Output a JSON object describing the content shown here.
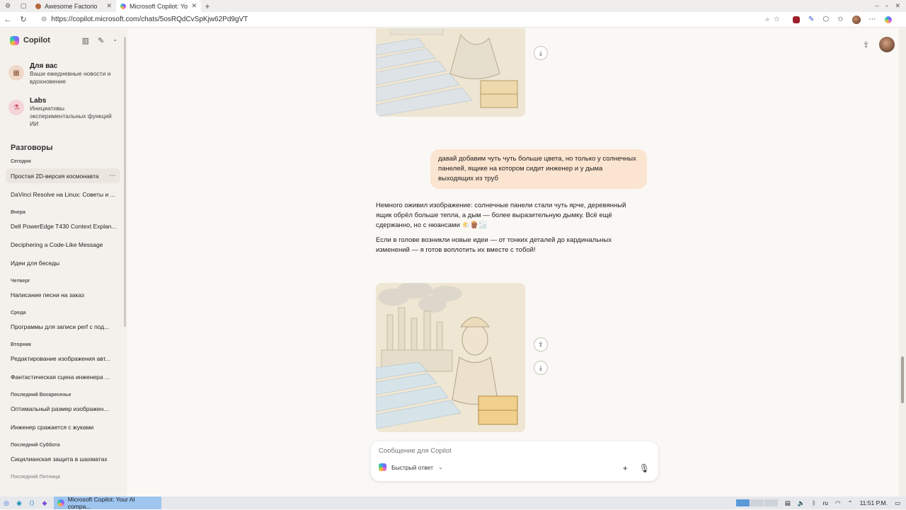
{
  "browser": {
    "tabs": [
      {
        "title": "Awesome Factorio",
        "active": false,
        "icon_color": "#b7683b"
      },
      {
        "title": "Microsoft Copilot: Your",
        "active": true,
        "icon_color": "#4f8cf7"
      }
    ],
    "url": "https://copilot.microsoft.com/chats/5osRQdCvSpKjw62Pd9gVT"
  },
  "sidebar": {
    "brand": "Copilot",
    "features": [
      {
        "title": "Для вас",
        "desc": "Ваши ежедневные новости и вдохновение",
        "icon": "grid-icon"
      },
      {
        "title": "Labs",
        "desc": "Инициативы экспериментальных функций ИИ",
        "icon": "flask-icon"
      }
    ],
    "section_title": "Разговоры",
    "groups": [
      {
        "label": "Сегодня",
        "items": [
          "Простая 2D-версия космонавта",
          "DaVinci Resolve на Linux: Советы и ..."
        ]
      },
      {
        "label": "Вчера",
        "items": [
          "Dell PowerEdge T430 Context Explan...",
          "Deciphering a Code-Like Message",
          "Идеи для беседы"
        ]
      },
      {
        "label": "Четверг",
        "items": [
          "Написание песни на заказ"
        ]
      },
      {
        "label": "Среда",
        "items": [
          "Программы для записи perf с под..."
        ]
      },
      {
        "label": "Вторник",
        "items": [
          "Редактирование изображения авт...",
          "Фантастическая сцена инженера ..."
        ]
      },
      {
        "label": "Последний Воскресенье",
        "items": [
          "Оптимальный размер изображен...",
          "Инженер сражается с жуками"
        ]
      },
      {
        "label": "Последний Суббота",
        "items": [
          "Сицилианская защита в шахматах"
        ]
      },
      {
        "label": "Последний Пятница",
        "items": []
      }
    ]
  },
  "chat": {
    "user_message": "давай добавим чуть чуть больше цвета, но только у солнечных панелей, ящике на котором сидит инженер и у дыма выходящих из труб",
    "bot_paragraphs": [
      "Немного оживил изображение: солнечные панели стали чуть ярче, деревянный ящик обрёл больше тепла, а дым — более выразительную дымку. Всё ещё сдержанно, но с нюансами 🌤️🪵🌫️",
      "Если в голове возникли новые идеи — от тонких деталей до кардинальных изменений — я готов воплотить их вместе с тобой!"
    ],
    "composer": {
      "placeholder": "Сообщение для Copilot",
      "mode_label": "Быстрый ответ"
    }
  },
  "taskbar": {
    "active_task": "Microsoft Copilot: Your AI compa...",
    "lang": "ru",
    "time": "11:51 P.M."
  },
  "colors": {
    "accent_user_bubble": "#fbe4d0",
    "background": "#faf8f5",
    "sidebar_bg": "#f4f1ed"
  }
}
